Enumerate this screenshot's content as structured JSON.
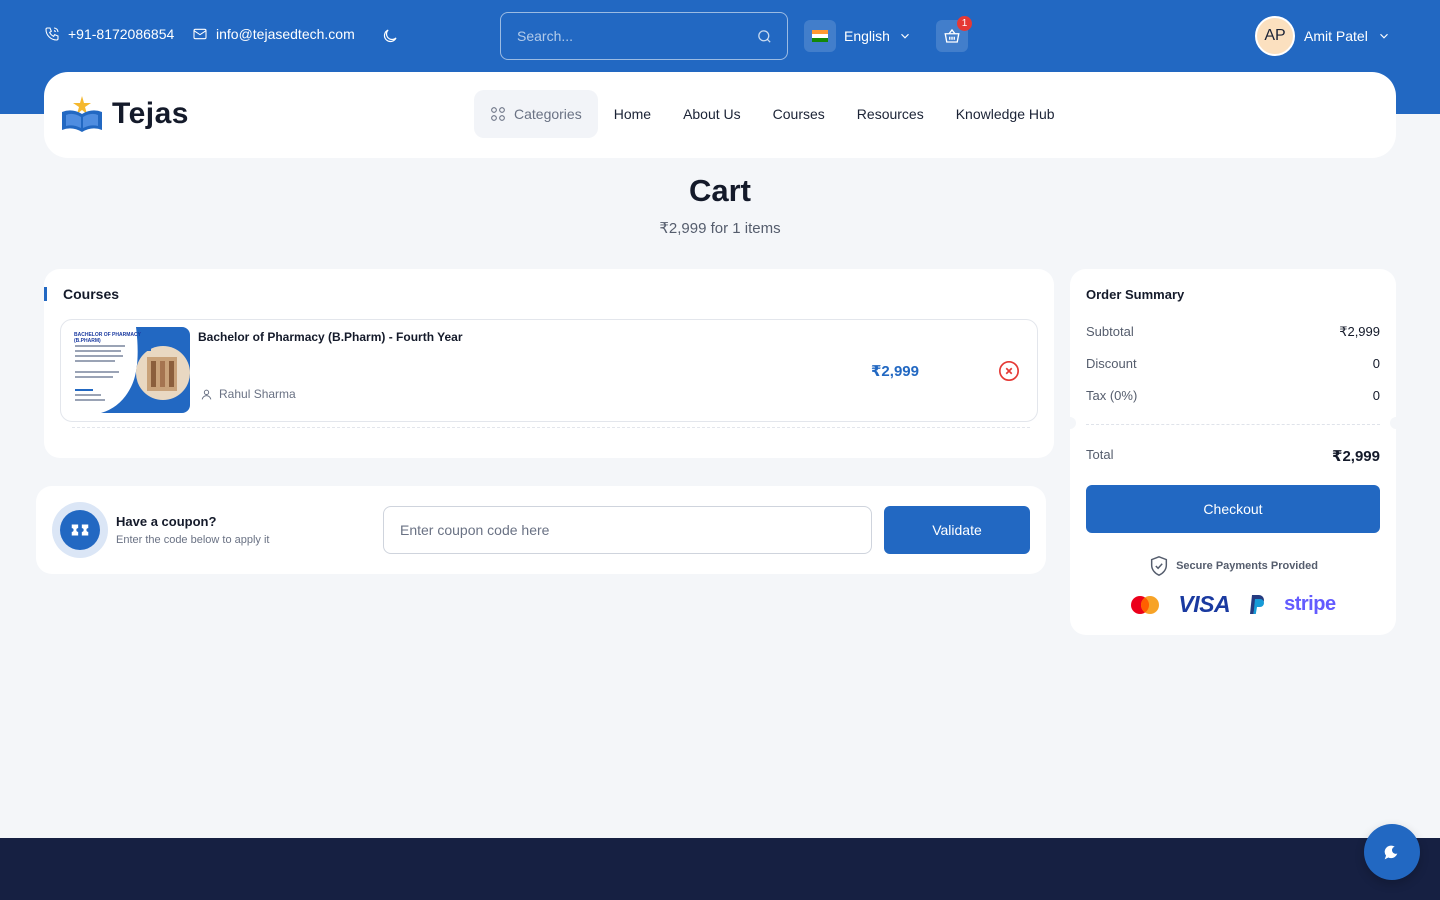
{
  "topbar": {
    "phone": "+91-8172086854",
    "email": "info@tejasedtech.com",
    "search_placeholder": "Search...",
    "language": "English",
    "cart_count": "1",
    "user_initials": "AP",
    "user_name": "Amit Patel"
  },
  "nav": {
    "logo_text": "Tejas",
    "categories": "Categories",
    "links": [
      "Home",
      "About Us",
      "Courses",
      "Resources",
      "Knowledge Hub"
    ]
  },
  "page": {
    "title": "Cart",
    "subtitle": "₹2,999 for 1 items"
  },
  "courses": {
    "section_label": "Courses",
    "items": [
      {
        "title": "Bachelor of Pharmacy (B.Pharm) - Fourth Year",
        "author": "Rahul Sharma",
        "price": "₹2,999",
        "thumbnail_heading": "BACHELOR OF PHARMACY (B.PHARM)"
      }
    ]
  },
  "coupon": {
    "title": "Have a coupon?",
    "subtitle": "Enter the code below to apply it",
    "placeholder": "Enter coupon code here",
    "button": "Validate"
  },
  "summary": {
    "title": "Order Summary",
    "rows": [
      {
        "label": "Subtotal",
        "value": "₹2,999"
      },
      {
        "label": "Discount",
        "value": "0"
      },
      {
        "label": "Tax (0%)",
        "value": "0"
      }
    ],
    "total_label": "Total",
    "total_value": "₹2,999",
    "checkout": "Checkout",
    "secure_text": "Secure Payments Provided",
    "payment_methods": {
      "visa": "VISA",
      "stripe": "stripe"
    }
  },
  "colors": {
    "primary": "#2268c2",
    "footer": "#162042",
    "danger": "#e53935"
  }
}
